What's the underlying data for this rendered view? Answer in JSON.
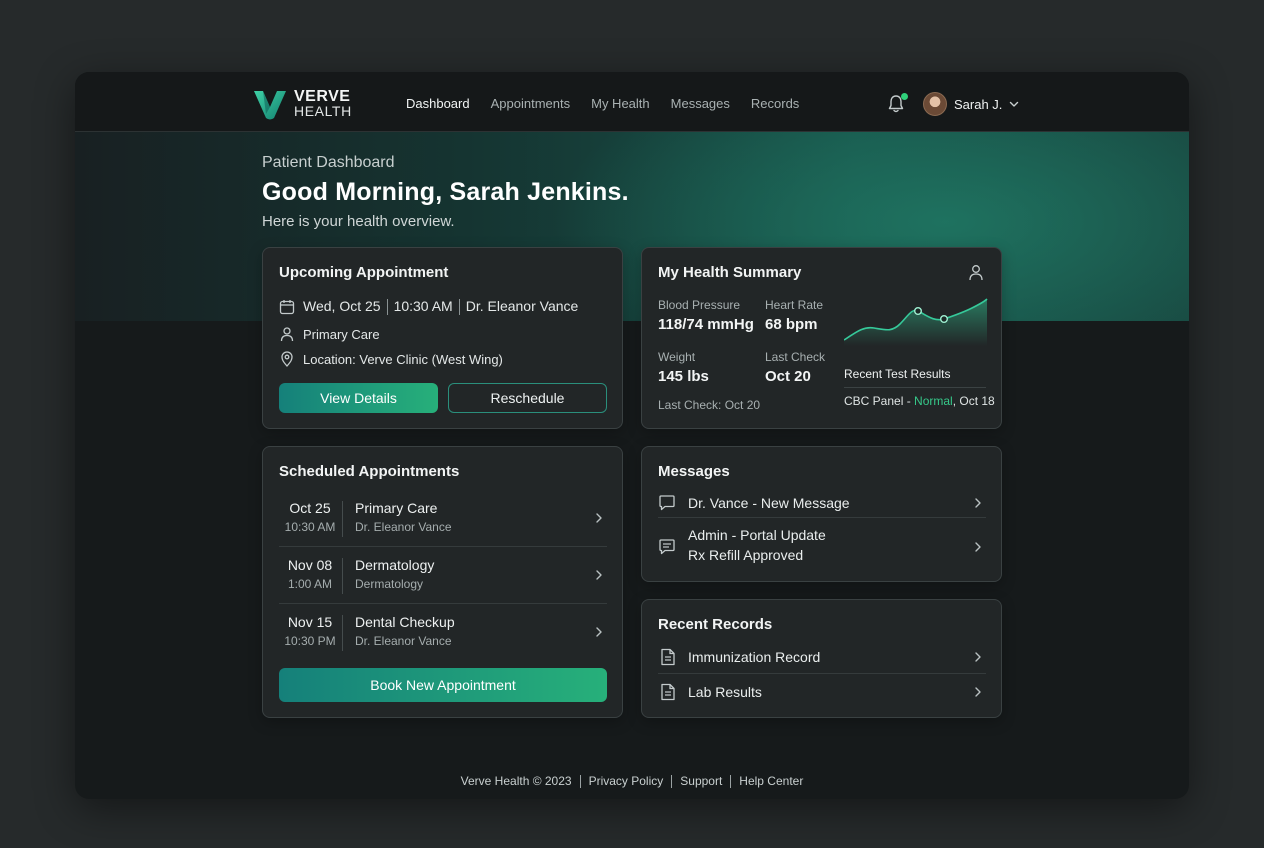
{
  "brand": {
    "line1": "VERVE",
    "line2": "HEALTH"
  },
  "nav": [
    {
      "label": "Dashboard",
      "active": true
    },
    {
      "label": "Appointments",
      "active": false
    },
    {
      "label": "My Health",
      "active": false
    },
    {
      "label": "Messages",
      "active": false
    },
    {
      "label": "Records",
      "active": false
    }
  ],
  "user": {
    "name": "Sarah J."
  },
  "hero": {
    "subtitle": "Patient Dashboard",
    "greeting": "Good Morning, Sarah Jenkins.",
    "description": "Here is your health overview."
  },
  "upcoming": {
    "title": "Upcoming Appointment",
    "date": "Wed, Oct 25",
    "time": "10:30 AM",
    "doctor": "Dr. Eleanor Vance",
    "type": "Primary Care",
    "location": "Location: Verve Clinic (West Wing)",
    "view_label": "View Details",
    "reschedule_label": "Reschedule"
  },
  "summary": {
    "title": "My Health Summary",
    "bp_label": "Blood Pressure",
    "bp_value": "118/74 mmHg",
    "hr_label": "Heart Rate",
    "hr_value": "68 bpm",
    "weight_label": "Weight",
    "weight_value": "145 lbs",
    "lastcheck_label": "Last Check",
    "lastcheck_value": "Oct 20",
    "footer_note": "Last Check: Oct 20",
    "tests_title": "Recent Test Results",
    "test_name": "CBC Panel - ",
    "test_status": "Normal",
    "test_date": ", Oct 18"
  },
  "scheduled": {
    "title": "Scheduled Appointments",
    "rows": [
      {
        "date": "Oct 25",
        "time": "10:30 AM",
        "name": "Primary Care",
        "sub": "Dr. Eleanor Vance"
      },
      {
        "date": "Nov 08",
        "time": "1:00 AM",
        "name": "Dermatology",
        "sub": "Dermatology"
      },
      {
        "date": "Nov 15",
        "time": "10:30 PM",
        "name": "Dental Checkup",
        "sub": "Dr. Eleanor Vance"
      }
    ],
    "book_label": "Book New Appointment"
  },
  "messages": {
    "title": "Messages",
    "items": [
      {
        "line1": "Dr. Vance - New Message"
      },
      {
        "line1": "Admin - Portal Update",
        "line2": "Rx Refill Approved"
      }
    ]
  },
  "records": {
    "title": "Recent Records",
    "items": [
      {
        "label": "Immunization Record"
      },
      {
        "label": "Lab Results"
      }
    ]
  },
  "footer": {
    "copyright": "Verve Health © 2023",
    "privacy": "Privacy Policy",
    "support": "Support",
    "help": "Help Center"
  },
  "colors": {
    "accent": "#27b07a",
    "teal": "#15807a",
    "status_green": "#2fd07a"
  }
}
